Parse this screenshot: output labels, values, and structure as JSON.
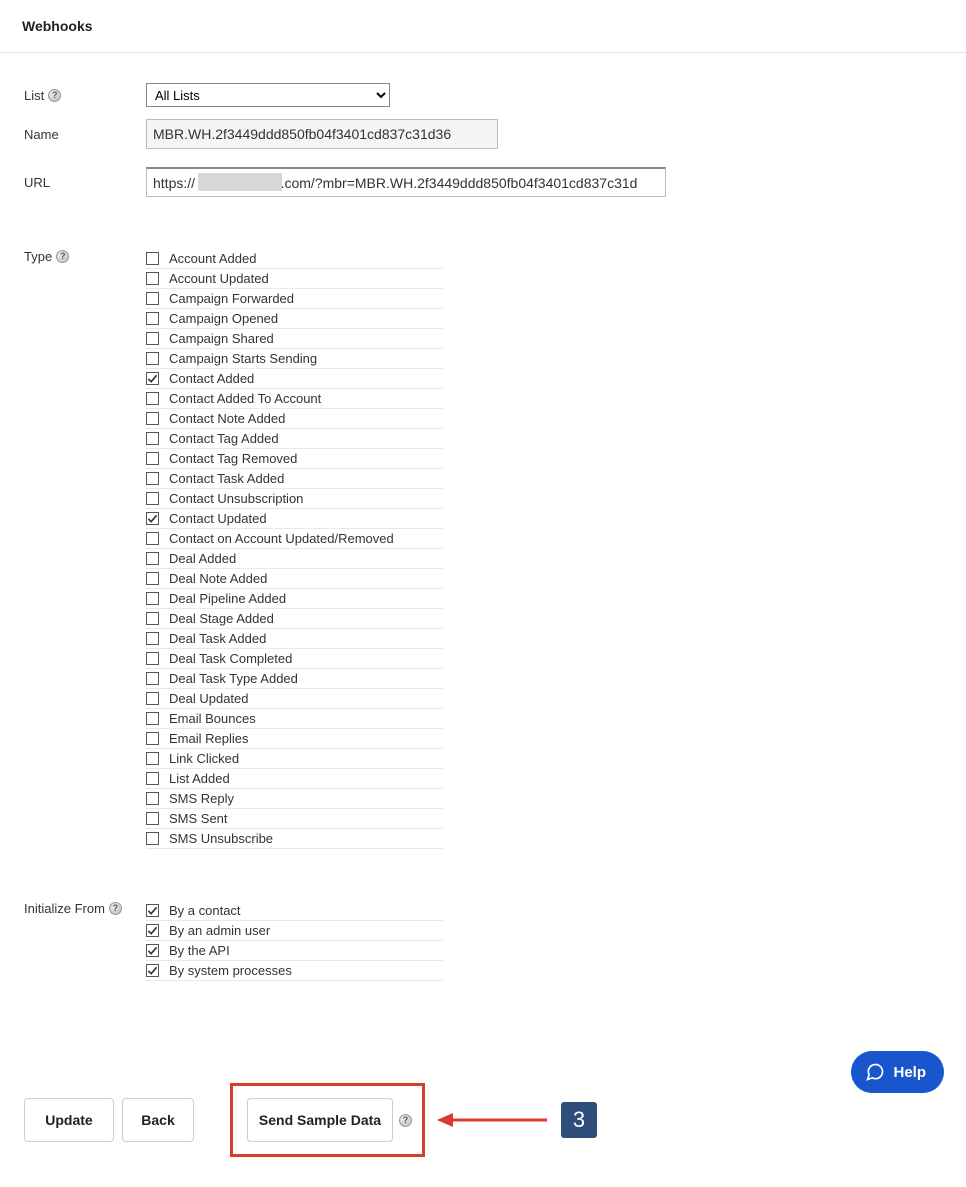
{
  "page": {
    "title": "Webhooks"
  },
  "fields": {
    "list_label": "List",
    "list_value": "All Lists",
    "name_label": "Name",
    "name_value": "MBR.WH.2f3449ddd850fb04f3401cd837c31d36",
    "url_label": "URL",
    "url_value": "https://                      .com/?mbr=MBR.WH.2f3449ddd850fb04f3401cd837c31d",
    "type_label": "Type",
    "init_label": "Initialize From"
  },
  "type_options": [
    {
      "label": "Account Added",
      "checked": false
    },
    {
      "label": "Account Updated",
      "checked": false
    },
    {
      "label": "Campaign Forwarded",
      "checked": false
    },
    {
      "label": "Campaign Opened",
      "checked": false
    },
    {
      "label": "Campaign Shared",
      "checked": false
    },
    {
      "label": "Campaign Starts Sending",
      "checked": false
    },
    {
      "label": "Contact Added",
      "checked": true
    },
    {
      "label": "Contact Added To Account",
      "checked": false
    },
    {
      "label": "Contact Note Added",
      "checked": false
    },
    {
      "label": "Contact Tag Added",
      "checked": false
    },
    {
      "label": "Contact Tag Removed",
      "checked": false
    },
    {
      "label": "Contact Task Added",
      "checked": false
    },
    {
      "label": "Contact Unsubscription",
      "checked": false
    },
    {
      "label": "Contact Updated",
      "checked": true
    },
    {
      "label": "Contact on Account Updated/Removed",
      "checked": false
    },
    {
      "label": "Deal Added",
      "checked": false
    },
    {
      "label": "Deal Note Added",
      "checked": false
    },
    {
      "label": "Deal Pipeline Added",
      "checked": false
    },
    {
      "label": "Deal Stage Added",
      "checked": false
    },
    {
      "label": "Deal Task Added",
      "checked": false
    },
    {
      "label": "Deal Task Completed",
      "checked": false
    },
    {
      "label": "Deal Task Type Added",
      "checked": false
    },
    {
      "label": "Deal Updated",
      "checked": false
    },
    {
      "label": "Email Bounces",
      "checked": false
    },
    {
      "label": "Email Replies",
      "checked": false
    },
    {
      "label": "Link Clicked",
      "checked": false
    },
    {
      "label": "List Added",
      "checked": false
    },
    {
      "label": "SMS Reply",
      "checked": false
    },
    {
      "label": "SMS Sent",
      "checked": false
    },
    {
      "label": "SMS Unsubscribe",
      "checked": false
    }
  ],
  "init_options": [
    {
      "label": "By a contact",
      "checked": true
    },
    {
      "label": "By an admin user",
      "checked": true
    },
    {
      "label": "By the API",
      "checked": true
    },
    {
      "label": "By system processes",
      "checked": true
    }
  ],
  "buttons": {
    "update": "Update",
    "back": "Back",
    "sample": "Send Sample Data"
  },
  "annotation": {
    "step": "3"
  },
  "help": {
    "label": "Help"
  }
}
